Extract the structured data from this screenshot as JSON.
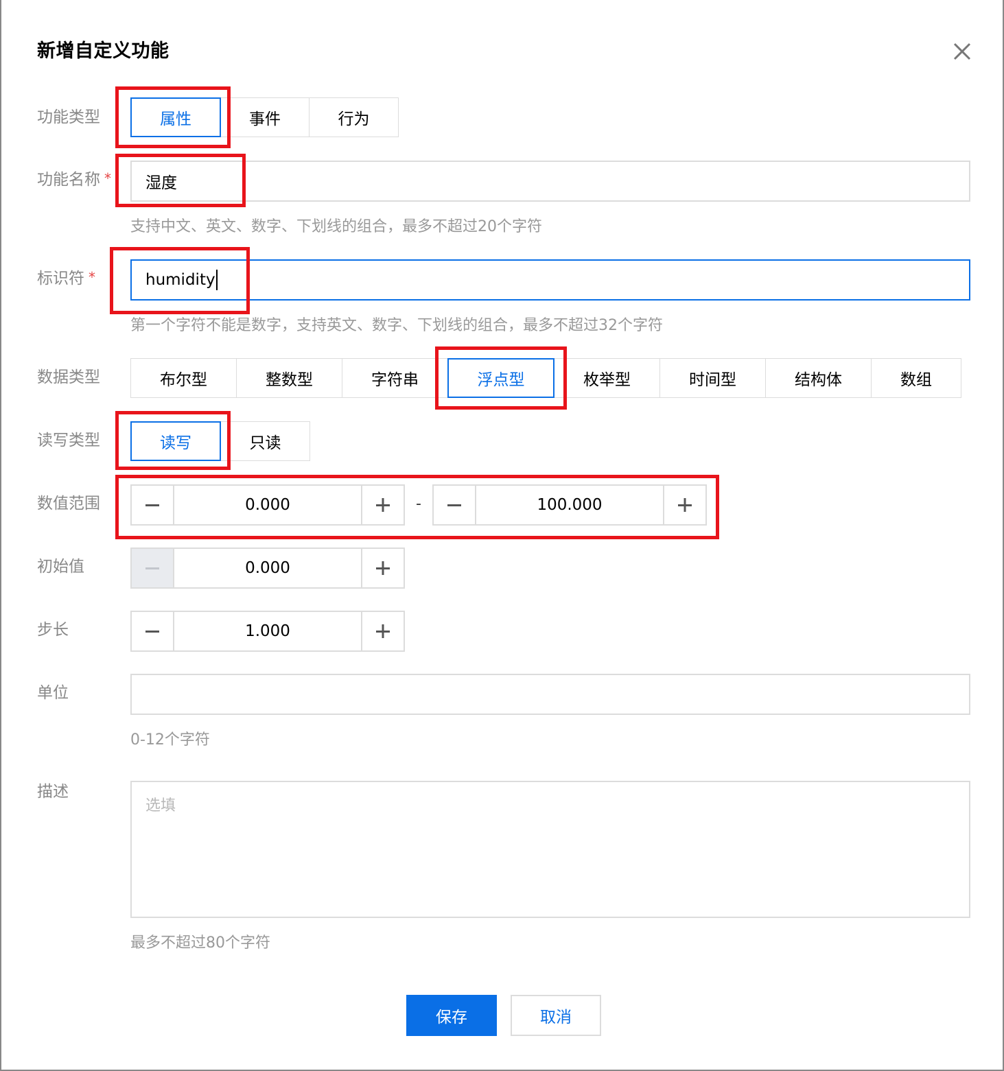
{
  "dialog": {
    "title": "新增自定义功能",
    "close_icon": "close-icon"
  },
  "function_type": {
    "label": "功能类型",
    "options": [
      "属性",
      "事件",
      "行为"
    ],
    "selected": "属性"
  },
  "function_name": {
    "label": "功能名称",
    "required_mark": "*",
    "value": "湿度",
    "hint": "支持中文、英文、数字、下划线的组合，最多不超过20个字符"
  },
  "identifier": {
    "label": "标识符",
    "required_mark": "*",
    "value": "humidity",
    "hint": "第一个字符不能是数字，支持英文、数字、下划线的组合，最多不超过32个字符"
  },
  "data_type": {
    "label": "数据类型",
    "options": [
      "布尔型",
      "整数型",
      "字符串",
      "浮点型",
      "枚举型",
      "时间型",
      "结构体",
      "数组"
    ],
    "selected": "浮点型"
  },
  "rw_type": {
    "label": "读写类型",
    "options": [
      "读写",
      "只读"
    ],
    "selected": "读写"
  },
  "value_range": {
    "label": "数值范围",
    "min": "0.000",
    "separator": "-",
    "max": "100.000"
  },
  "initial_value": {
    "label": "初始值",
    "value": "0.000"
  },
  "step": {
    "label": "步长",
    "value": "1.000"
  },
  "unit": {
    "label": "单位",
    "value": "",
    "hint": "0-12个字符"
  },
  "description": {
    "label": "描述",
    "placeholder": "选填",
    "hint": "最多不超过80个字符"
  },
  "footer": {
    "save_label": "保存",
    "cancel_label": "取消"
  },
  "colors": {
    "primary": "#0a6fe6",
    "highlight": "#e8141b",
    "required": "#e54545"
  }
}
